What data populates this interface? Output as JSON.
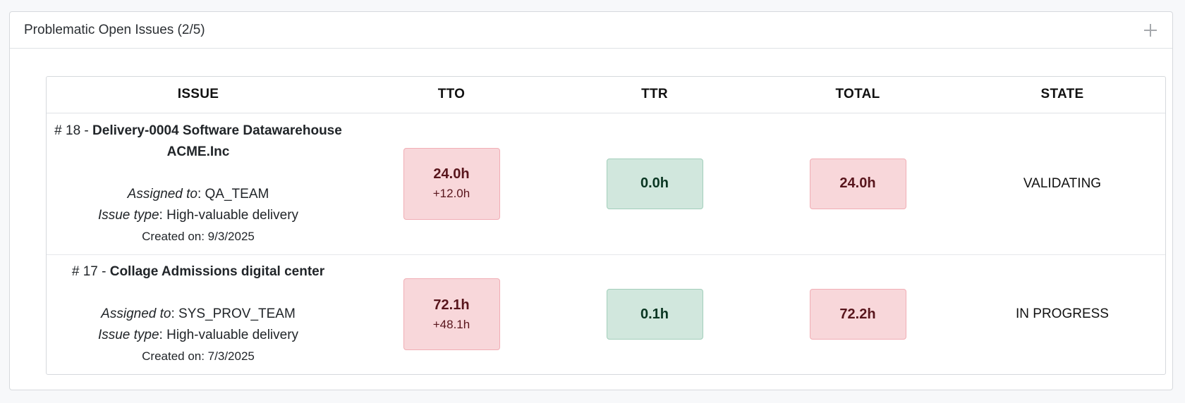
{
  "panel": {
    "title": "Problematic Open Issues (2/5)",
    "expand_icon": "plus-icon"
  },
  "table": {
    "headers": [
      "ISSUE",
      "TTO",
      "TTR",
      "TOTAL",
      "STATE"
    ],
    "rows": [
      {
        "number": "# 18 -",
        "title": "Delivery-0004 Software Datawarehouse ACME.Inc",
        "assigned_label": "Assigned to",
        "assigned_value": ": QA_TEAM",
        "type_label": "Issue type",
        "type_value": ": High-valuable delivery",
        "created": "Created on: 9/3/2025",
        "tto": "24.0h",
        "tto_delta": "+12.0h",
        "ttr": "0.0h",
        "total": "24.0h",
        "state": "VALIDATING"
      },
      {
        "number": "# 17 -",
        "title": "Collage Admissions digital center",
        "assigned_label": "Assigned to",
        "assigned_value": ": SYS_PROV_TEAM",
        "type_label": "Issue type",
        "type_value": ": High-valuable delivery",
        "created": "Created on: 7/3/2025",
        "tto": "72.1h",
        "tto_delta": "+48.1h",
        "ttr": "0.1h",
        "total": "72.2h",
        "state": "IN PROGRESS"
      }
    ]
  },
  "colors": {
    "danger_bg": "#f8d7da",
    "success_bg": "#d1e7dd"
  }
}
